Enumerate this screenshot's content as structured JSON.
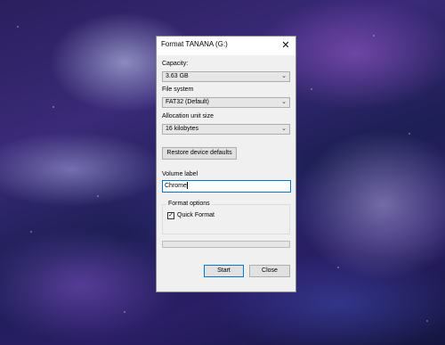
{
  "dialog": {
    "title": "Format TANANA (G:)",
    "close_glyph": "✕",
    "capacity": {
      "label": "Capacity:",
      "value": "3.63 GB"
    },
    "file_system": {
      "label": "File system",
      "value": "FAT32 (Default)"
    },
    "allocation": {
      "label": "Allocation unit size",
      "value": "16 kilobytes"
    },
    "restore_label": "Restore device defaults",
    "volume_label": {
      "label": "Volume label",
      "value": "Chrome"
    },
    "format_options": {
      "title": "Format options",
      "quick_format_label": "Quick Format",
      "quick_format_checked": true,
      "check_glyph": "✓"
    },
    "progress": 0,
    "start_label": "Start",
    "close_label": "Close",
    "chevron_glyph": "⌄"
  },
  "icons": [
    "close-icon",
    "chevron-down-icon",
    "checkmark-icon"
  ],
  "colors": {
    "focus_border": "#0078d7",
    "dialog_bg": "#f0f0f0"
  }
}
